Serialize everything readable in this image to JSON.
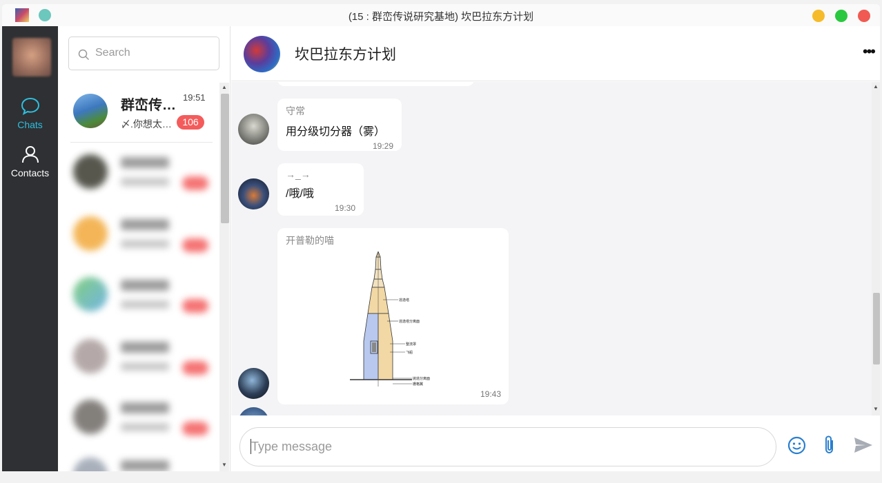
{
  "window": {
    "title": "(15 : 群峦传说研究基地) 坎巴拉东方计划"
  },
  "colors": {
    "accent": "#2dbfe0",
    "badge": "#f45b5b",
    "rail_bg": "#2e3033",
    "icon_blue": "#2a7fcf"
  },
  "rail": {
    "items": [
      {
        "label": "Chats",
        "icon": "chat-bubble-icon",
        "active": true
      },
      {
        "label": "Contacts",
        "icon": "person-icon",
        "active": false
      }
    ]
  },
  "search": {
    "placeholder": "Search"
  },
  "conversations": [
    {
      "name": "群峦传说研究基地",
      "time": "19:51",
      "preview": "〆.你想太多了",
      "badge": "106"
    }
  ],
  "chat": {
    "name": "坎巴拉东方计划",
    "messages": [
      {
        "sender": "守常",
        "text": "用分级切分器（雾）",
        "time": "19:29"
      },
      {
        "sender": "→_→",
        "text": "/哦/哦",
        "time": "19:30"
      },
      {
        "sender": "开普勒的喵",
        "text": "",
        "time": "19:43",
        "image": {
          "labels": [
            "逃逸塔",
            "逃逸塔分离面",
            "整流罩",
            "飞船",
            "抛逃分离面",
            "栅格翼"
          ]
        }
      }
    ]
  },
  "composer": {
    "placeholder": "Type message"
  }
}
